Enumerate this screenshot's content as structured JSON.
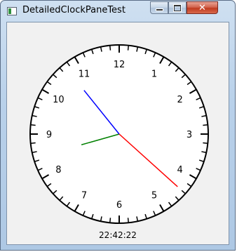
{
  "window": {
    "title": "DetailedClockPaneTest",
    "icon": "app-window-icon",
    "buttons": {
      "minimize": "minimize-icon",
      "maximize": "maximize-icon",
      "close": "close-icon"
    }
  },
  "clock": {
    "numerals": [
      "12",
      "1",
      "2",
      "3",
      "4",
      "5",
      "6",
      "7",
      "8",
      "9",
      "10",
      "11"
    ],
    "time": {
      "hour": 22,
      "minute": 42,
      "second": 22
    },
    "digital_time": "22:42:22",
    "colors": {
      "face": "#ffffff",
      "outline": "#000000",
      "hour_hand": "#0000ff",
      "minute_hand": "#008000",
      "second_hand": "#ff0000",
      "window_background": "#f1f1f1"
    }
  }
}
